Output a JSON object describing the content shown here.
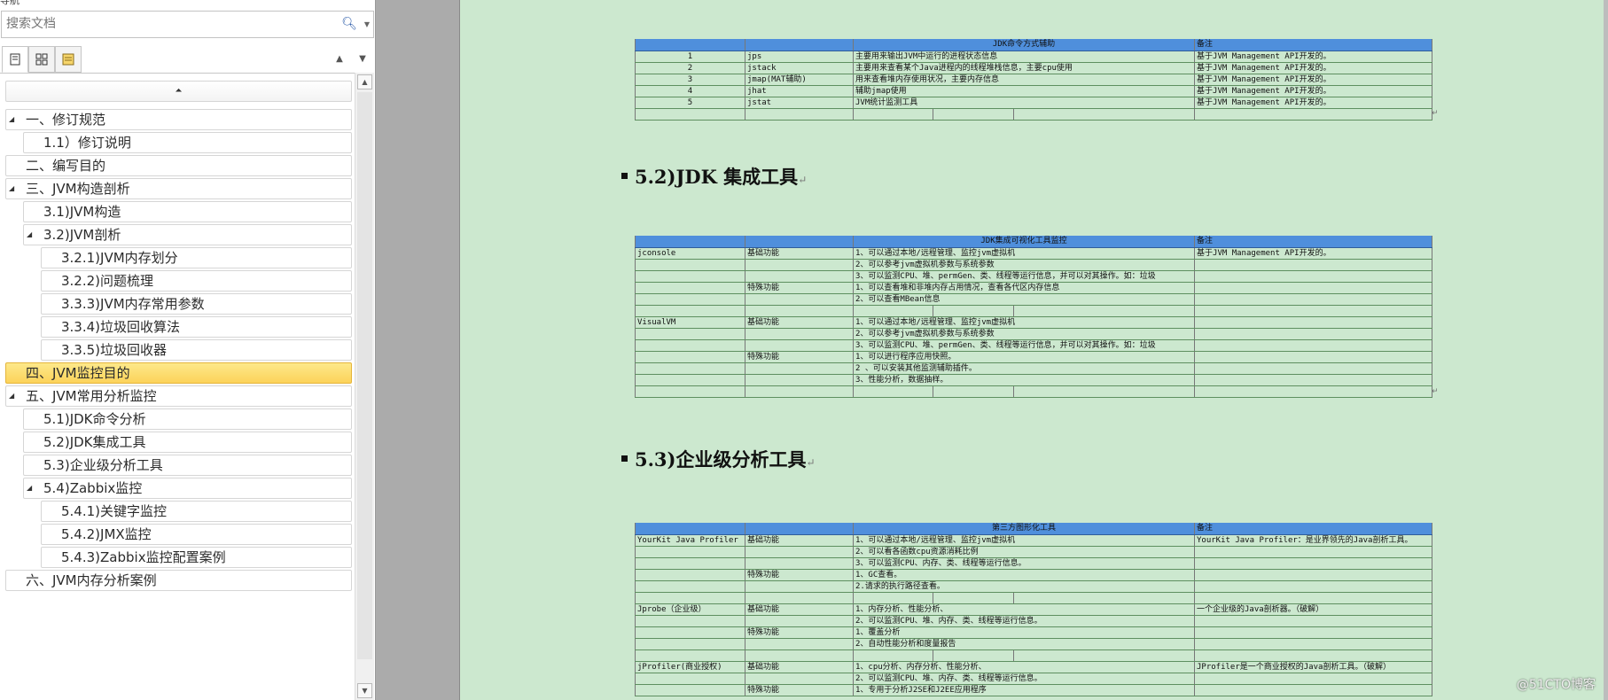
{
  "nav": {
    "title": "导航",
    "search_placeholder": "搜索文档",
    "tree_collapse_symbol": "⏶",
    "items": [
      {
        "label": "一、修订规范",
        "level": 0,
        "expandable": true
      },
      {
        "label": "1.1）修订说明",
        "level": 1,
        "expandable": false
      },
      {
        "label": "二、编写目的",
        "level": 0,
        "expandable": false
      },
      {
        "label": "三、JVM构造剖析",
        "level": 0,
        "expandable": true
      },
      {
        "label": "3.1)JVM构造",
        "level": 1,
        "expandable": false
      },
      {
        "label": "3.2)JVM剖析",
        "level": 1,
        "expandable": true
      },
      {
        "label": "3.2.1)JVM内存划分",
        "level": 2,
        "expandable": false
      },
      {
        "label": "3.2.2)问题梳理",
        "level": 2,
        "expandable": false
      },
      {
        "label": "3.3.3)JVM内存常用参数",
        "level": 2,
        "expandable": false
      },
      {
        "label": "3.3.4)垃圾回收算法",
        "level": 2,
        "expandable": false
      },
      {
        "label": "3.3.5)垃圾回收器",
        "level": 2,
        "expandable": false
      },
      {
        "label": "四、JVM监控目的",
        "level": 0,
        "expandable": false,
        "active": true
      },
      {
        "label": "五、JVM常用分析监控",
        "level": 0,
        "expandable": true
      },
      {
        "label": "5.1)JDK命令分析",
        "level": 1,
        "expandable": false
      },
      {
        "label": "5.2)JDK集成工具",
        "level": 1,
        "expandable": false
      },
      {
        "label": "5.3)企业级分析工具",
        "level": 1,
        "expandable": false
      },
      {
        "label": "5.4)Zabbix监控",
        "level": 1,
        "expandable": true
      },
      {
        "label": "5.4.1)关键字监控",
        "level": 2,
        "expandable": false
      },
      {
        "label": "5.4.2)JMX监控",
        "level": 2,
        "expandable": false
      },
      {
        "label": "5.4.3)Zabbix监控配置案例",
        "level": 2,
        "expandable": false
      },
      {
        "label": "六、JVM内存分析案例",
        "level": 0,
        "expandable": false
      }
    ]
  },
  "doc": {
    "heading_52": "5.2)JDK 集成工具",
    "heading_53": "5.3)企业级分析工具",
    "return_mark": "↵",
    "table1": {
      "header": [
        "",
        "",
        "JDK命令方式辅助",
        "",
        "",
        "备注"
      ],
      "rows": [
        [
          "1",
          "jps",
          "主要用来输出JVM中运行的进程状态信息",
          "",
          "",
          "基于JVM Management API开发的。"
        ],
        [
          "2",
          "jstack",
          "主要用来查看某个Java进程内的线程堆栈信息，主要cpu使用",
          "",
          "",
          "基于JVM Management API开发的。"
        ],
        [
          "3",
          "jmap(MAT辅助)",
          "用来查看堆内存使用状况，主要内存信息",
          "",
          "",
          "基于JVM Management API开发的。"
        ],
        [
          "4",
          "jhat",
          "辅助jmap使用",
          "",
          "",
          "基于JVM Management API开发的。"
        ],
        [
          "5",
          "jstat",
          "JVM统计监测工具",
          "",
          "",
          "基于JVM Management API开发的。"
        ],
        [
          "",
          "",
          "",
          "",
          "",
          ""
        ]
      ]
    },
    "table2": {
      "header": [
        "",
        "",
        "JDK集成可视化工具监控",
        "",
        "",
        "备注"
      ],
      "rows": [
        [
          "jconsole",
          "基础功能",
          "1、可以通过本地/远程管理、监控jvm虚拟机",
          "",
          "",
          "基于JVM Management API开发的。"
        ],
        [
          "",
          "",
          "2、可以参考jvm虚拟机参数与系统参数",
          "",
          "",
          ""
        ],
        [
          "",
          "",
          "3、可以监测CPU、堆、permGen、类、线程等运行信息，并可以对其操作。如：垃圾",
          "",
          "",
          ""
        ],
        [
          "",
          "特殊功能",
          "1、可以查看堆和非堆内存占用情况，查看各代区内存信息",
          "",
          "",
          ""
        ],
        [
          "",
          "",
          "2、可以查看MBean信息",
          "",
          "",
          ""
        ],
        [
          "",
          "",
          "",
          "",
          "",
          ""
        ],
        [
          "VisualVM",
          "基础功能",
          "1、可以通过本地/远程管理、监控jvm虚拟机",
          "",
          "",
          ""
        ],
        [
          "",
          "",
          "2、可以参考jvm虚拟机参数与系统参数",
          "",
          "",
          ""
        ],
        [
          "",
          "",
          "3、可以监测CPU、堆、permGen、类、线程等运行信息，并可以对其操作。如：垃圾",
          "",
          "",
          ""
        ],
        [
          "",
          "特殊功能",
          "1、可以进行程序应用快照。",
          "",
          "",
          ""
        ],
        [
          "",
          "",
          "2 、可以安装其他监测辅助插件。",
          "",
          "",
          ""
        ],
        [
          "",
          "",
          "3、性能分析，数据抽样。",
          "",
          "",
          ""
        ],
        [
          "",
          "",
          "",
          "",
          "",
          ""
        ]
      ]
    },
    "table3": {
      "header": [
        "",
        "",
        "第三方图形化工具",
        "",
        "",
        "备注"
      ],
      "rows": [
        [
          "YourKit Java Profiler",
          "基础功能",
          "1、可以通过本地/远程管理、监控jvm虚拟机",
          "",
          "",
          "YourKit Java Profiler：是业界领先的Java剖析工具。"
        ],
        [
          "",
          "",
          "2、可以看各函数cpu资源消耗比例",
          "",
          "",
          ""
        ],
        [
          "",
          "",
          "3、可以监测CPU、内存、类、线程等运行信息。",
          "",
          "",
          ""
        ],
        [
          "",
          "特殊功能",
          "1、GC查看。",
          "",
          "",
          ""
        ],
        [
          "",
          "",
          "2.请求的执行路径查看。",
          "",
          "",
          ""
        ],
        [
          "",
          "",
          "",
          "",
          "",
          ""
        ],
        [
          "Jprobe（企业级）",
          "基础功能",
          "1、内存分析、性能分析、",
          "",
          "",
          "一个企业级的Java剖析器。（破解）"
        ],
        [
          "",
          "",
          "2、可以监测CPU、堆、内存、类、线程等运行信息。",
          "",
          "",
          ""
        ],
        [
          "",
          "特殊功能",
          "1、覆盖分析",
          "",
          "",
          ""
        ],
        [
          "",
          "",
          "2、自动性能分析和度量报告",
          "",
          "",
          ""
        ],
        [
          "",
          "",
          "",
          "",
          "",
          ""
        ],
        [
          "jProfiler(商业授权)",
          "基础功能",
          "1、cpu分析、内存分析、性能分析、",
          "",
          "",
          "JProfiler是一个商业授权的Java剖析工具。（破解）"
        ],
        [
          "",
          "",
          "2、可以监测CPU、堆、内存、类、线程等运行信息。",
          "",
          "",
          ""
        ],
        [
          "",
          "特殊功能",
          "1、专用于分析J2SE和J2EE应用程序",
          "",
          "",
          ""
        ]
      ]
    }
  },
  "watermark": "@51CTO博客",
  "colors": {
    "page_bg": "#cce8cf",
    "table_header": "#4f8fdc",
    "active_item": "#fcd35a"
  }
}
